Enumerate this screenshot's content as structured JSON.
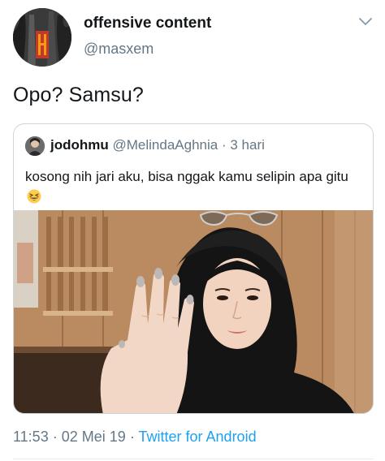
{
  "author": {
    "display_name": "offensive content",
    "handle": "@masxem"
  },
  "tweet": {
    "text": "Opo? Samsu?"
  },
  "quoted": {
    "display_name": "jodohmu",
    "handle": "@MelindaAghnia",
    "separator": "·",
    "time": "3 hari",
    "text": "kosong nih jari aku, bisa nggak kamu selipin apa gitu",
    "emoji": "grinning-squinting-face-icon"
  },
  "meta": {
    "time": "11:53",
    "separator1": "·",
    "date": "02 Mei 19",
    "separator2": "·",
    "client": "Twitter for Android"
  },
  "colors": {
    "text_primary": "#14171a",
    "text_secondary": "#657786",
    "link": "#1da1f2",
    "border": "#ccd6dd"
  }
}
